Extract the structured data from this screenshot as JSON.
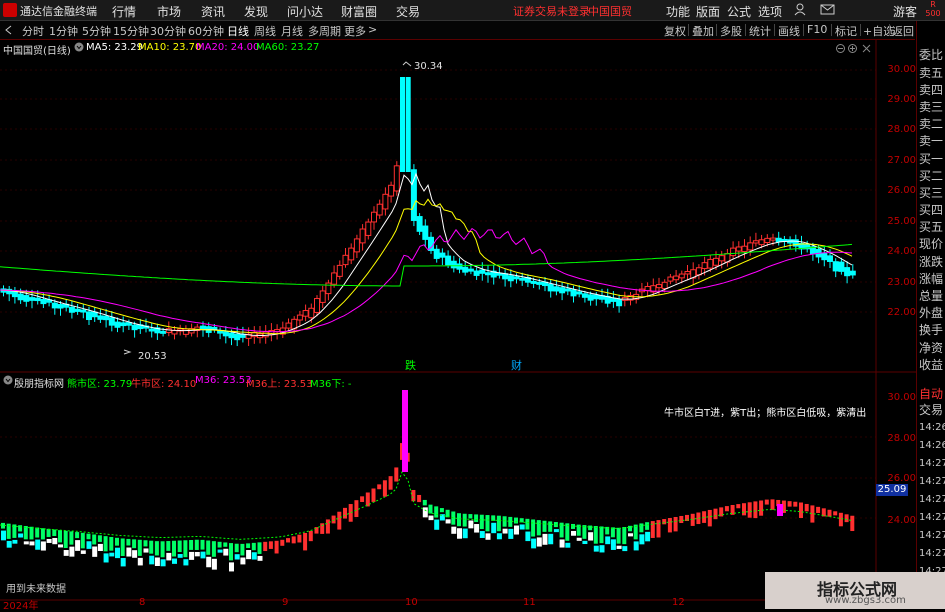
{
  "titlebar": {
    "app_name": "通达信金融终端",
    "menus": [
      "行情",
      "市场",
      "资讯",
      "发现",
      "问小达",
      "财富圈",
      "交易"
    ],
    "warning": "证券交易未登录",
    "stock_tag": "中国国贸",
    "right_menus": [
      "功能",
      "版面",
      "公式",
      "选项"
    ],
    "guest": "游客",
    "r_badge": "R",
    "r_num": "500"
  },
  "periods": [
    "分时",
    "1分钟",
    "5分钟",
    "15分钟",
    "30分钟",
    "60分钟",
    "日线",
    "周线",
    "月线",
    "多周期",
    "更多"
  ],
  "active_period": "日线",
  "more_arrow": ">",
  "toolbar": [
    "复权",
    "叠加",
    "多股",
    "统计",
    "画线",
    "F10",
    "标记",
    "+自选",
    "返回"
  ],
  "main_chart": {
    "stock": "中国国贸(日线)",
    "ma": [
      {
        "label": "MA5: 23.29",
        "color": "#ffffff"
      },
      {
        "label": "MA10: 23.70",
        "color": "#ffff00"
      },
      {
        "label": "MA20: 24.00",
        "color": "#ff00ff"
      },
      {
        "label": "MA60: 23.27",
        "color": "#00ff00"
      }
    ],
    "yticks": [
      "30.00",
      "29.00",
      "28.00",
      "27.00",
      "26.00",
      "25.00",
      "24.00",
      "23.00",
      "22.00"
    ],
    "high_label": "30.34",
    "low_label": "20.53",
    "marker_die": "跌",
    "marker_cai": "财"
  },
  "indicator": {
    "name": "殷朋指标网",
    "legend": [
      {
        "label": "熊市区: 23.79",
        "color": "#00ff00"
      },
      {
        "label": "牛市区: 24.10",
        "color": "#ff3030"
      },
      {
        "label": "M36: 23.53",
        "color": "#ff00ff"
      },
      {
        "label": "M36上: 23.53",
        "color": "#ff3030"
      },
      {
        "label": "M36下: -",
        "color": "#00ff00"
      }
    ],
    "note": "牛市区白T进，紫T出；熊市区白低吸，紫清出",
    "yticks": [
      "30.00",
      "28.00",
      "26.00",
      "24.00"
    ],
    "current_price": "25.09",
    "footer_text": "用到未来数据"
  },
  "xaxis": [
    "2024年",
    "8",
    "9",
    "10",
    "11",
    "12"
  ],
  "right_panel": {
    "items": [
      "委比",
      "卖五",
      "卖四",
      "卖三",
      "卖二",
      "卖一",
      "买一",
      "买二",
      "买三",
      "买四",
      "买五",
      "现价",
      "涨跌",
      "涨幅",
      "总量",
      "外盘",
      "换手",
      "净资",
      "收益"
    ],
    "sub_items": [
      "自动",
      "交易"
    ],
    "times": [
      "14:26",
      "14:26",
      "14:27",
      "14:27",
      "14:27",
      "14:27",
      "14:27",
      "14:27",
      "14:27"
    ]
  },
  "watermark": {
    "title": "指标公式网",
    "url": "www.zbgs3.com"
  }
}
